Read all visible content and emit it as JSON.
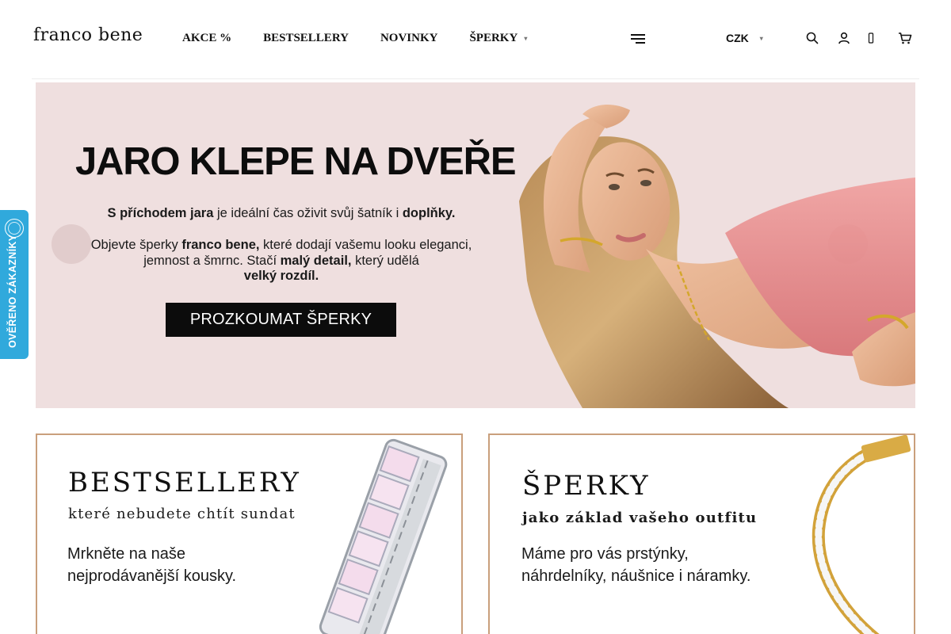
{
  "header": {
    "logo": "franco bene",
    "nav": [
      {
        "label": "AKCE %"
      },
      {
        "label": "BESTSELLERY"
      },
      {
        "label": "NOVINKY"
      },
      {
        "label": "ŠPERKY"
      }
    ],
    "currency": "CZK",
    "icons": [
      "menu-icon",
      "search-icon",
      "user-icon",
      "heart-icon",
      "cart-icon"
    ]
  },
  "hero": {
    "title": "JARO KLEPE NA DVEŘE",
    "line1_a": "S příchodem jara",
    "line1_b": " je ideální čas oživit svůj šatník i ",
    "line1_c": "doplňky.",
    "line2_a": "Objevte šperky ",
    "line2_b": "franco bene,",
    "line2_c": " které dodají vašemu looku eleganci, jemnost a šmrnc. Stačí ",
    "line2_d": "malý detail,",
    "line2_e": " který udělá ",
    "line2_f": "velký rozdíl.",
    "cta": "PROZKOUMAT ŠPERKY",
    "background_color": "#efdfdf"
  },
  "cards": [
    {
      "title": "BESTSELLERY",
      "subtitle": "které nebudete chtít sundat",
      "desc_line1": "Mrkněte na naše",
      "desc_line2": "nejprodávanější kousky."
    },
    {
      "title": "ŠPERKY",
      "subtitle": "jako základ vašeho outfitu",
      "desc_line1": "Máme pro vás prstýnky,",
      "desc_line2": "náhrdelníky, náušnice i náramky."
    }
  ],
  "badge": {
    "text": "OVĚŘENO ZÁKAZNÍKY",
    "color": "#30a9dc"
  },
  "colors": {
    "card_border": "#c99f7c",
    "cta_background": "#0c0c0c"
  }
}
